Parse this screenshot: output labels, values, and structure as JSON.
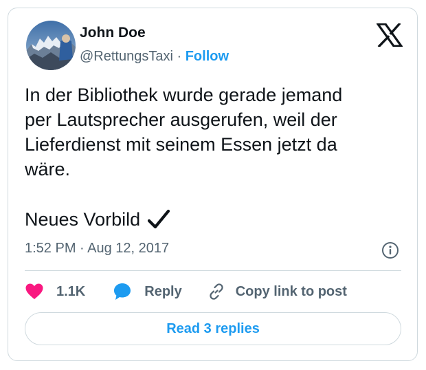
{
  "author": {
    "name": "John Doe",
    "handle": "@RettungsTaxi",
    "separator": "·",
    "follow_label": "Follow"
  },
  "tweet": {
    "text": "In der Bibliothek wurde gerade jemand\nper Lautsprecher ausgerufen, weil der\nLieferdienst mit seinem Essen jetzt da\nwäre.",
    "closing": "Neues Vorbild",
    "timestamp": "1:52 PM · Aug 12, 2017"
  },
  "actions": {
    "like_count": "1.1K",
    "reply_label": "Reply",
    "copy_link_label": "Copy link to post"
  },
  "read_replies_label": "Read 3 replies",
  "icons": {
    "platform": "x-logo-icon",
    "like": "heart-icon",
    "reply": "speech-bubble-icon",
    "copy": "link-icon",
    "info": "info-icon",
    "checkmark": "checkmark-icon"
  },
  "colors": {
    "accent": "#1d9bf0",
    "like": "#f91880",
    "text": "#0f1419",
    "secondary": "#536471",
    "border": "#cfd9de"
  }
}
